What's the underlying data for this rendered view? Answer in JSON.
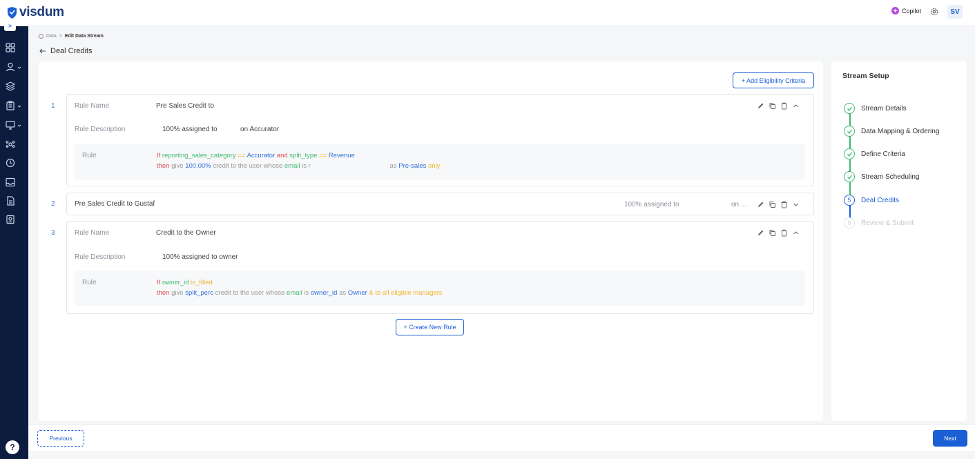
{
  "brand": {
    "name": "visdum",
    "color": "#1a5fd3"
  },
  "topbar": {
    "copilot_label": "Copilot",
    "avatar_initials": "SV",
    "settings_icon": "gear-icon"
  },
  "breadcrumb": {
    "root": "Data",
    "current": "Edit Data Stream"
  },
  "page": {
    "title": "Deal Credits"
  },
  "actions": {
    "add_eligibility": "+ Add Eligibility Criteria",
    "create_rule": "+ Create New Rule"
  },
  "rules": [
    {
      "number": "1",
      "name_label": "Rule Name",
      "name": "Pre Sales Credit to",
      "desc_label": "Rule Description",
      "desc_part1": "100% assigned to",
      "desc_part2": "on Accurator",
      "rule_label": "Rule",
      "line1": {
        "if": "If",
        "f1": "reporting_sales_category",
        "op1": "==",
        "v1": "Accurator",
        "and": "and",
        "f2": "split_type",
        "op2": "==",
        "v2": "Revenue"
      },
      "line2": {
        "then": "then",
        "give": "give",
        "amount": "100.00%",
        "mid": "credit to the user whose",
        "email": "email",
        "is": "is",
        "masked": "r",
        "as": "as",
        "role": "Pre-sales",
        "only": "only"
      }
    },
    {
      "number": "2",
      "title": "Pre Sales Credit to Gustaf",
      "desc_part1": "100% assigned to",
      "desc_part2": "on ..."
    },
    {
      "number": "3",
      "name_label": "Rule Name",
      "name": "Credit to the Owner",
      "desc_label": "Rule Description",
      "desc": "100% assigned to owner",
      "rule_label": "Rule",
      "line1": {
        "if": "If",
        "f1": "owner_id",
        "op": "is_filled"
      },
      "line2": {
        "then": "then",
        "give": "give",
        "amount": "split_perc",
        "mid": "credit to the user whose",
        "email": "email",
        "is": "is",
        "field": "owner_id",
        "as": "as",
        "role": "Owner",
        "tail": "& to all eligible managers"
      }
    }
  ],
  "stream_setup": {
    "title": "Stream Setup",
    "steps": [
      {
        "label": "Stream Details",
        "state": "done"
      },
      {
        "label": "Data Mapping & Ordering",
        "state": "done"
      },
      {
        "label": "Define Criteria",
        "state": "done"
      },
      {
        "label": "Stream Scheduling",
        "state": "done"
      },
      {
        "label": "Deal Credits",
        "state": "current",
        "number": "5"
      },
      {
        "label": "Review & Submit",
        "state": "pending",
        "number": "6"
      }
    ]
  },
  "footer": {
    "previous": "Previous",
    "next": "Next"
  },
  "help": "?"
}
